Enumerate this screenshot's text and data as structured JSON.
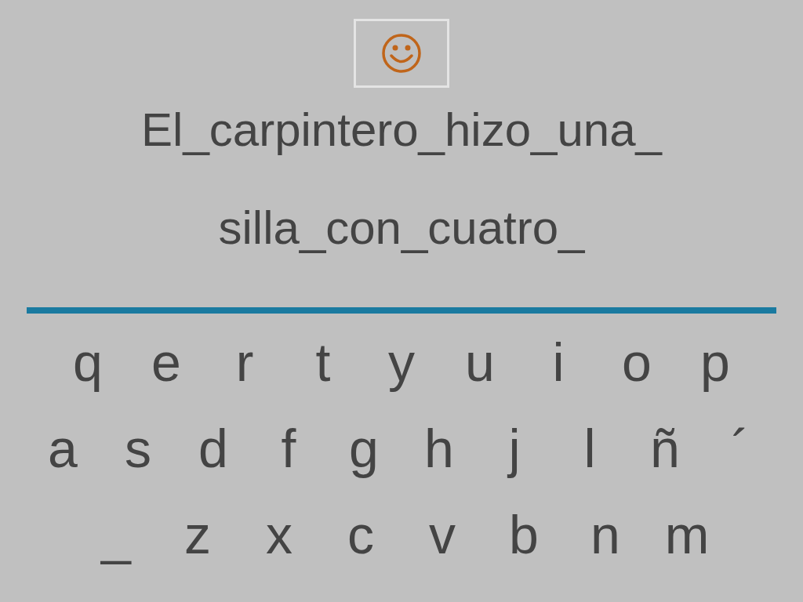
{
  "sentence_lines": [
    "El_carpintero_hizo_una_",
    "silla_con_cuatro_"
  ],
  "keyboard_rows": [
    [
      "q",
      "e",
      "r",
      "t",
      "y",
      "u",
      "i",
      "o",
      "p"
    ],
    [
      "a",
      "s",
      "d",
      "f",
      "g",
      "h",
      "j",
      "l",
      "ñ",
      "´"
    ],
    [
      "_",
      "z",
      "x",
      "c",
      "v",
      "b",
      "n",
      "m"
    ]
  ]
}
